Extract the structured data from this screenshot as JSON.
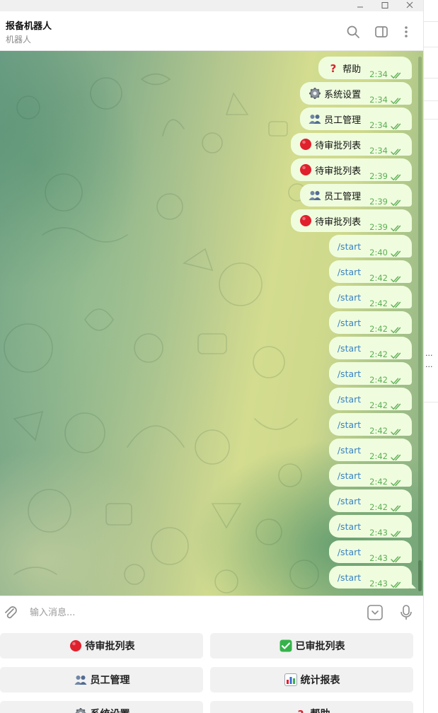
{
  "chat": {
    "title": "报备机器人",
    "subtitle": "机器人"
  },
  "messages": [
    {
      "icon": "question-icon",
      "text": "帮助",
      "time": "2:34",
      "command": false
    },
    {
      "icon": "gear-icon",
      "text": "系统设置",
      "time": "2:34",
      "command": false
    },
    {
      "icon": "people-icon",
      "text": "员工管理",
      "time": "2:34",
      "command": false
    },
    {
      "icon": "red-circle-icon",
      "text": "待审批列表",
      "time": "2:34",
      "command": false
    },
    {
      "icon": "red-circle-icon",
      "text": "待审批列表",
      "time": "2:39",
      "command": false
    },
    {
      "icon": "people-icon",
      "text": "员工管理",
      "time": "2:39",
      "command": false
    },
    {
      "icon": "red-circle-icon",
      "text": "待审批列表",
      "time": "2:39",
      "command": false
    },
    {
      "icon": "",
      "text": "/start",
      "time": "2:40",
      "command": true
    },
    {
      "icon": "",
      "text": "/start",
      "time": "2:42",
      "command": true
    },
    {
      "icon": "",
      "text": "/start",
      "time": "2:42",
      "command": true
    },
    {
      "icon": "",
      "text": "/start",
      "time": "2:42",
      "command": true
    },
    {
      "icon": "",
      "text": "/start",
      "time": "2:42",
      "command": true
    },
    {
      "icon": "",
      "text": "/start",
      "time": "2:42",
      "command": true
    },
    {
      "icon": "",
      "text": "/start",
      "time": "2:42",
      "command": true
    },
    {
      "icon": "",
      "text": "/start",
      "time": "2:42",
      "command": true
    },
    {
      "icon": "",
      "text": "/start",
      "time": "2:42",
      "command": true
    },
    {
      "icon": "",
      "text": "/start",
      "time": "2:42",
      "command": true
    },
    {
      "icon": "",
      "text": "/start",
      "time": "2:42",
      "command": true
    },
    {
      "icon": "",
      "text": "/start",
      "time": "2:43",
      "command": true
    },
    {
      "icon": "",
      "text": "/start",
      "time": "2:43",
      "command": true
    },
    {
      "icon": "",
      "text": "/start",
      "time": "2:43",
      "command": true
    }
  ],
  "input": {
    "placeholder": "输入消息..."
  },
  "keyboard": [
    {
      "icon": "red-circle-icon",
      "label": "待审批列表"
    },
    {
      "icon": "check-icon",
      "label": "已审批列表"
    },
    {
      "icon": "people-icon",
      "label": "员工管理"
    },
    {
      "icon": "chart-icon",
      "label": "统计报表"
    },
    {
      "icon": "gear-icon",
      "label": "系统设置"
    },
    {
      "icon": "question-icon",
      "label": "帮助"
    }
  ],
  "side_panel": {
    "ellipsis_1": "...",
    "ellipsis_2": "..."
  },
  "colors": {
    "bubble": "#effdde",
    "time": "#5fae57",
    "command": "#3a82c4",
    "key_bg": "#f1f1f1"
  }
}
